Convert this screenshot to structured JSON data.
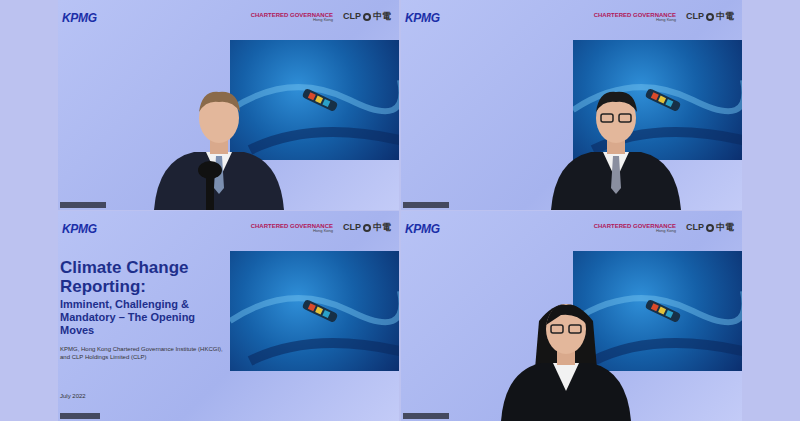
{
  "tiles": [
    {
      "kind": "person",
      "logos": {
        "kpmg": "KPMG",
        "cgi": "CHARTERED GOVERNANCE",
        "cgi_sub": "Hong Kong",
        "clp": "CLP",
        "clp_cn": "中電"
      }
    },
    {
      "kind": "person",
      "logos": {
        "kpmg": "KPMG",
        "cgi": "CHARTERED GOVERNANCE",
        "cgi_sub": "Hong Kong",
        "clp": "CLP",
        "clp_cn": "中電"
      }
    },
    {
      "kind": "slide",
      "logos": {
        "kpmg": "KPMG",
        "cgi": "CHARTERED GOVERNANCE",
        "cgi_sub": "Hong Kong",
        "clp": "CLP",
        "clp_cn": "中電"
      },
      "slide": {
        "title": "Climate Change Reporting:",
        "subtitle": "Imminent, Challenging & Mandatory – The Opening Moves",
        "authors": "KPMG, Hong Kong Chartered Governance Institute (HKCGI), and CLP Holdings Limited (CLP)",
        "date": "July 2022"
      }
    },
    {
      "kind": "person",
      "logos": {
        "kpmg": "KPMG",
        "cgi": "CHARTERED GOVERNANCE",
        "cgi_sub": "Hong Kong",
        "clp": "CLP",
        "clp_cn": "中電"
      }
    }
  ]
}
